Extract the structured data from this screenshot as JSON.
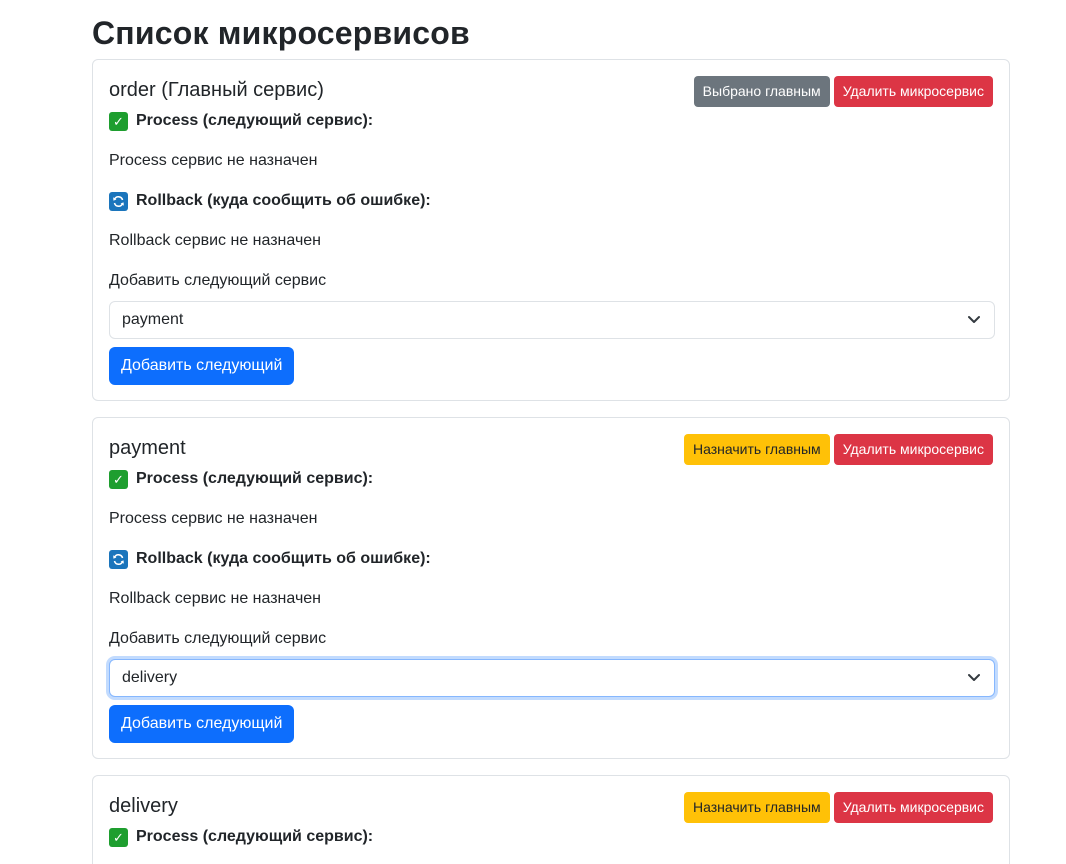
{
  "page": {
    "title": "Список микросервисов"
  },
  "colors": {
    "primary": "#0d6efd",
    "secondary": "#6c757d",
    "warning": "#ffc107",
    "danger": "#dc3545",
    "check_green": "#1e9e2f",
    "refresh_blue": "#1b75bc"
  },
  "services": [
    {
      "name": "order (Главный сервис)",
      "main_button_label": "Выбрано главным",
      "delete_button_label": "Удалить микросервис",
      "process_label": "Process (следующий сервис):",
      "process_value": "Process сервис не назначен",
      "rollback_label": "Rollback (куда сообщить об ошибке):",
      "rollback_value": "Rollback сервис не назначен",
      "add_next_label": "Добавить следующий сервис",
      "select_value": "payment",
      "add_button_label": "Добавить следующий"
    },
    {
      "name": "payment",
      "main_button_label": "Назначить главным",
      "delete_button_label": "Удалить микросервис",
      "process_label": "Process (следующий сервис):",
      "process_value": "Process сервис не назначен",
      "rollback_label": "Rollback (куда сообщить об ошибке):",
      "rollback_value": "Rollback сервис не назначен",
      "add_next_label": "Добавить следующий сервис",
      "select_value": "delivery",
      "add_button_label": "Добавить следующий"
    },
    {
      "name": "delivery",
      "main_button_label": "Назначить главным",
      "delete_button_label": "Удалить микросервис",
      "process_label": "Process (следующий сервис):"
    }
  ],
  "icons": {
    "check": "check-mark-button-icon",
    "rollback": "counterclockwise-arrows-icon",
    "select_arrow": "chevron-down-icon"
  }
}
